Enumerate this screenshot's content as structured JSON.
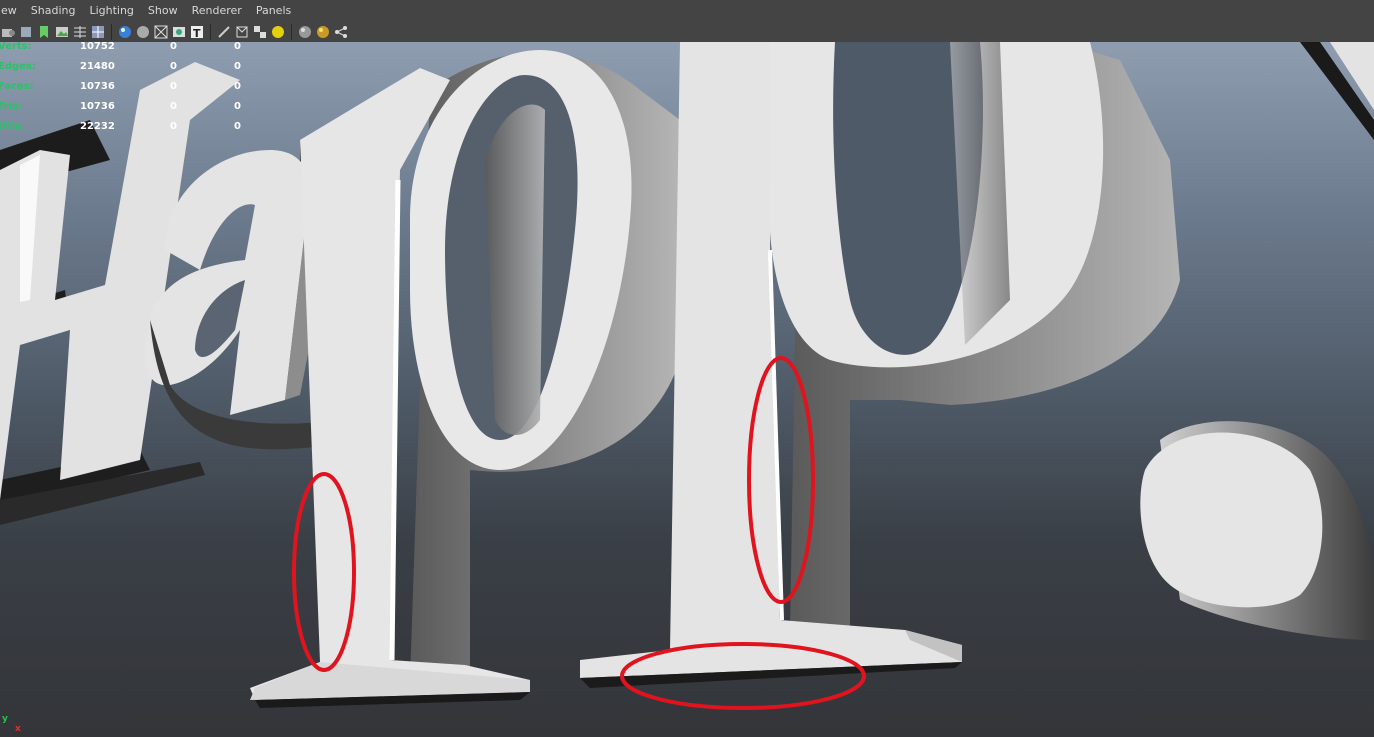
{
  "menubar": {
    "items": [
      {
        "id": "view",
        "label": "ew"
      },
      {
        "id": "shading",
        "label": "Shading"
      },
      {
        "id": "lighting",
        "label": "Lighting"
      },
      {
        "id": "show",
        "label": "Show"
      },
      {
        "id": "renderer",
        "label": "Renderer"
      },
      {
        "id": "panels",
        "label": "Panels"
      }
    ]
  },
  "toolbar": {
    "icons": [
      "camera-select-icon",
      "camera-attributes-icon",
      "bookmark-icon",
      "image-plane-icon",
      "grid-icon",
      "wireframe-icon",
      "smooth-shade-icon",
      "flat-shade-icon",
      "bounding-box-icon",
      "xray-icon",
      "textured-icon",
      "default-light-icon",
      "all-lights-icon",
      "shadows-icon",
      "isolate-select-icon",
      "frame-all-icon",
      "frame-selection-icon",
      "hierarchy-icon"
    ]
  },
  "hud": {
    "rows": [
      {
        "label": "Verts:",
        "object": "10752",
        "selected": "0",
        "component": "0"
      },
      {
        "label": "Edges:",
        "object": "21480",
        "selected": "0",
        "component": "0"
      },
      {
        "label": "Faces:",
        "object": "10736",
        "selected": "0",
        "component": "0"
      },
      {
        "label": "Tris:",
        "object": "10736",
        "selected": "0",
        "component": "0"
      },
      {
        "label": "UVs:",
        "object": "22232",
        "selected": "0",
        "component": "0"
      }
    ]
  },
  "axis": {
    "y": "y",
    "x": "x",
    "y_color": "#27c24c",
    "x_color": "#e03030"
  },
  "colors": {
    "annotation": "#e0141e",
    "letter_face": "#e3e3e3",
    "letter_side": "#9a9a9a"
  }
}
